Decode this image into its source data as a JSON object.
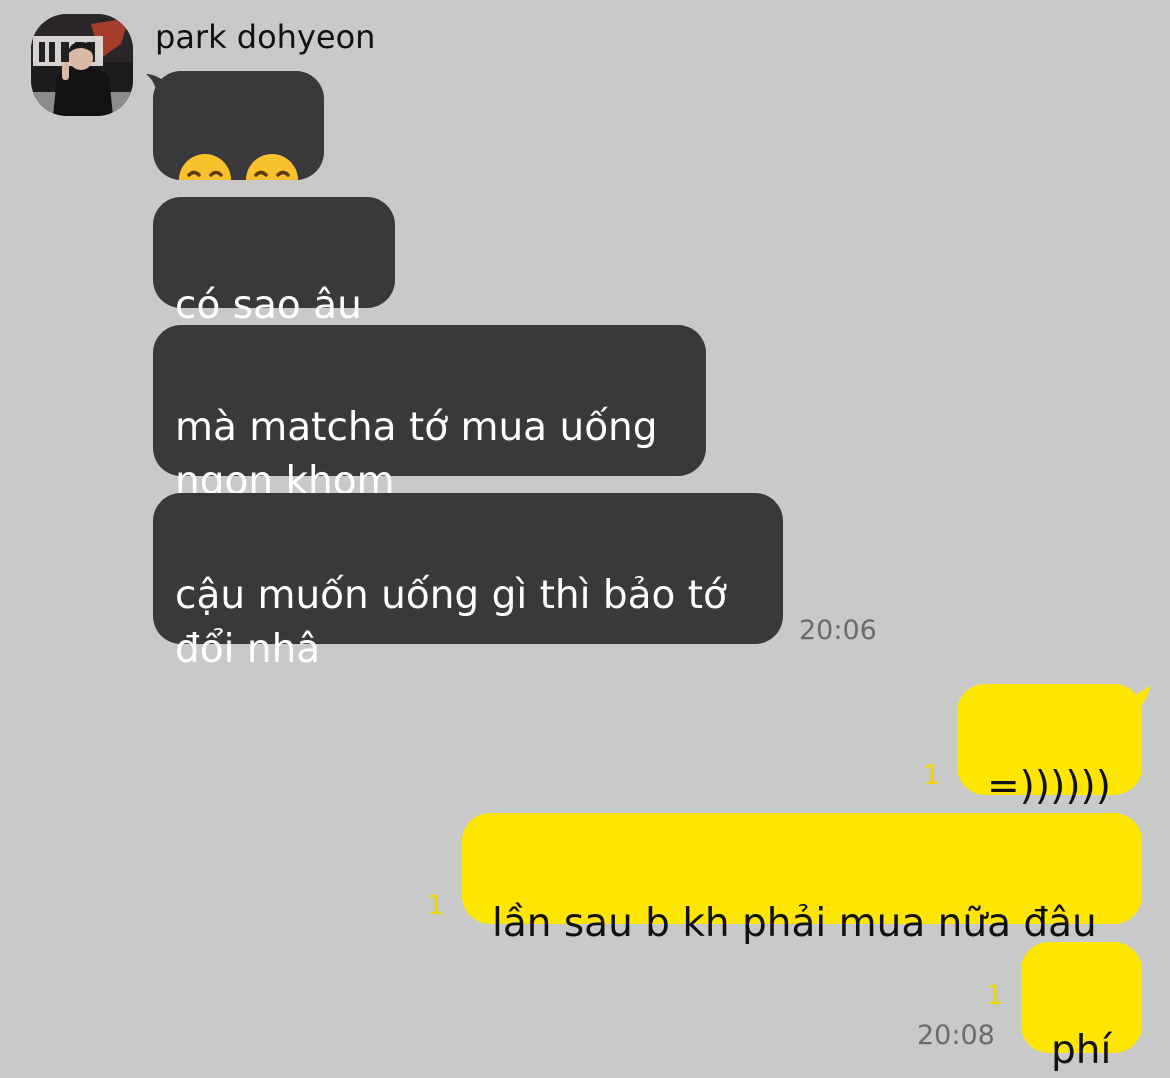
{
  "chat": {
    "sender_name": "park dohyeon",
    "incoming": [
      {
        "text": "🥲🥲",
        "icon": "smiling-face-with-tear-emoji"
      },
      {
        "text": "có sao âu"
      },
      {
        "text": "mà matcha tớ mua uống\nngon khom"
      },
      {
        "text": "cậu muốn uống gì thì bảo tớ\nđổi nhâ"
      }
    ],
    "incoming_time": "20:06",
    "outgoing": [
      {
        "text": "=))))))",
        "unread": "1"
      },
      {
        "text": "lần sau b kh phải mua nữa đâu",
        "unread": "1"
      },
      {
        "text": "phí",
        "unread": "1"
      }
    ],
    "outgoing_time": "20:08"
  },
  "colors": {
    "background": "#c9c9c9",
    "incoming_bubble": "#39393b",
    "outgoing_bubble": "#ffe600",
    "unread_count": "#f3d600",
    "timestamp": "#6b6b6b"
  }
}
